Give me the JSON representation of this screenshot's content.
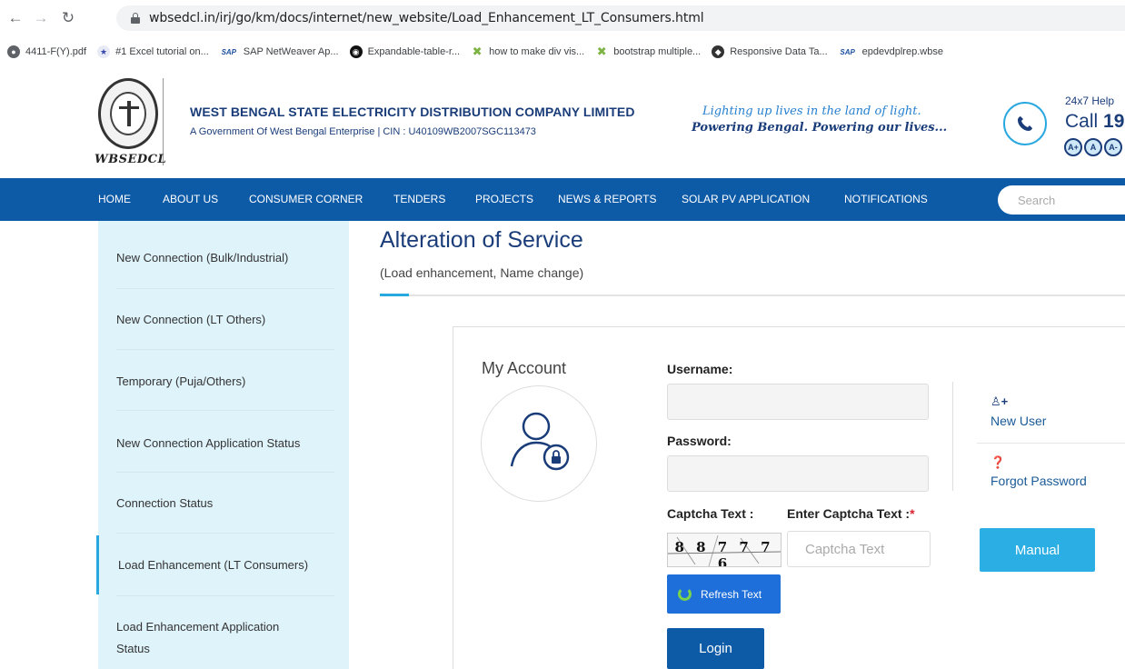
{
  "browser": {
    "url": "wbsedcl.in/irj/go/km/docs/internet/new_website/Load_Enhancement_LT_Consumers.html",
    "bookmarks": [
      {
        "label": "4411-F(Y).pdf",
        "icon": "globe-icon"
      },
      {
        "label": "#1 Excel tutorial on...",
        "icon": "excel-icon"
      },
      {
        "label": "SAP NetWeaver Ap...",
        "icon": "sap-icon"
      },
      {
        "label": "Expandable-table-r...",
        "icon": "github-icon"
      },
      {
        "label": "how to make div vis...",
        "icon": "stackoverflow-icon"
      },
      {
        "label": "bootstrap multiple...",
        "icon": "stackoverflow-icon"
      },
      {
        "label": "Responsive Data Ta...",
        "icon": "datatables-icon"
      },
      {
        "label": "epdevdplrep.wbse",
        "icon": "sap-icon"
      }
    ]
  },
  "header": {
    "logo_text": "WBSEDCL",
    "company_name": "WEST BENGAL STATE ELECTRICITY DISTRIBUTION COMPANY LIMITED",
    "company_sub": "A Government Of West Bengal Enterprise | CIN : U40109WB2007SGC113473",
    "tagline_1": "Lighting up lives in the land of light.",
    "tagline_2": "Powering Bengal. Powering our lives...",
    "helpline_label": "24x7 Help",
    "call_prefix": "Call ",
    "call_number": "19",
    "font_buttons": [
      "A+",
      "A",
      "A-"
    ]
  },
  "nav": {
    "items": [
      "HOME",
      "ABOUT US",
      "CONSUMER CORNER",
      "TENDERS",
      "PROJECTS",
      "NEWS & REPORTS",
      "SOLAR PV APPLICATION",
      "NOTIFICATIONS"
    ],
    "search_placeholder": "Search"
  },
  "sidebar": {
    "items": [
      {
        "label": "New Connection (Bulk/Industrial)"
      },
      {
        "label": "New Connection (LT Others)"
      },
      {
        "label": "Temporary (Puja/Others)"
      },
      {
        "label": "New Connection Application Status"
      },
      {
        "label": "Connection Status"
      },
      {
        "label": "Load Enhancement (LT Consumers)",
        "active": true
      },
      {
        "label_line1": "Load Enhancement Application",
        "label_line2": "Status"
      }
    ]
  },
  "main": {
    "title": "Alteration of Service",
    "subtitle": "(Load enhancement, Name change)",
    "my_account": "My Account",
    "username_label": "Username:",
    "password_label": "Password:",
    "captcha_label": "Captcha Text :",
    "enter_captcha_label": "Enter Captcha Text :",
    "required_mark": "*",
    "captcha_value": "8 8 7 7 7 6",
    "captcha_placeholder": "Captcha Text",
    "refresh_label": "Refresh Text",
    "login_label": "Login",
    "new_user_label": "New User",
    "forgot_password_label": "Forgot Password",
    "manual_label": "Manual"
  },
  "colors": {
    "nav_blue": "#0d5aa7",
    "accent_cyan": "#2aaee3",
    "sidebar_bg": "#dff3fb",
    "brand_navy": "#1a3d7a"
  }
}
